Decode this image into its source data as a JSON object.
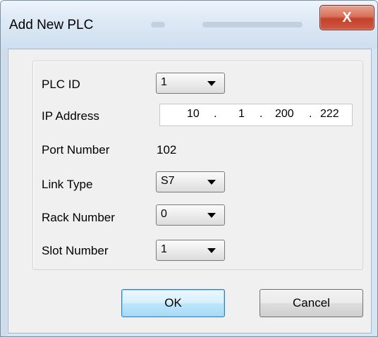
{
  "window": {
    "title": "Add New PLC",
    "close_glyph": "X",
    "title_blur_1": "lo",
    "title_blur_2": "(in texfo of n cooi"
  },
  "form": {
    "plc_id": {
      "label": "PLC ID",
      "value": "1"
    },
    "ip_address": {
      "label": "IP Address",
      "octets": [
        "10",
        "1",
        "200",
        "222"
      ],
      "separator": "."
    },
    "port_number": {
      "label": "Port Number",
      "value": "102"
    },
    "link_type": {
      "label": "Link Type",
      "value": "S7"
    },
    "rack_number": {
      "label": "Rack Number",
      "value": "0"
    },
    "slot_number": {
      "label": "Slot Number",
      "value": "1"
    }
  },
  "buttons": {
    "ok": "OK",
    "cancel": "Cancel"
  },
  "icons": {
    "close": "close-icon",
    "dropdown": "chevron-down-icon"
  },
  "colors": {
    "close_button": "#c3412b",
    "dialog_frame": "#d7e4f2",
    "client_background": "#f0f0f0",
    "default_button_border": "#3c7fb1"
  }
}
